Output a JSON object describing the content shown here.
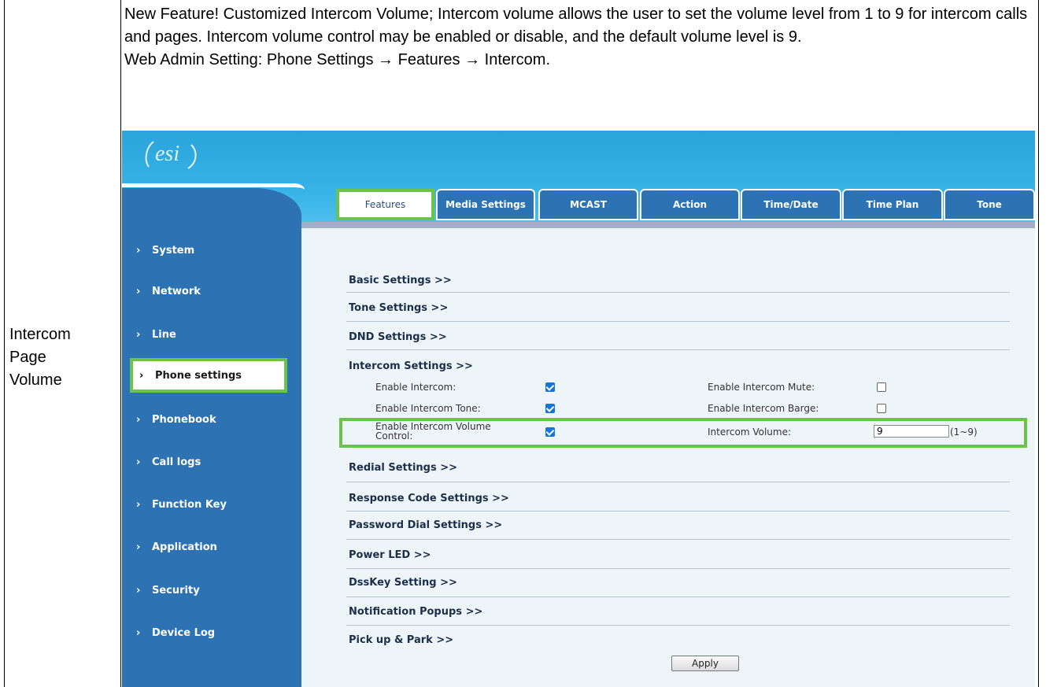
{
  "table": {
    "row_label_lines": [
      "Intercom",
      "Page",
      "Volume"
    ],
    "description": [
      "New Feature! Customized Intercom Volume; Intercom volume allows the user to set the volume level from 1 to 9 for intercom calls and pages. Intercom volume control may be enabled or disable, and the default volume level is 9.",
      "Web Admin Setting: Phone Settings → Features → Intercom."
    ]
  },
  "app": {
    "logo_text": "esi",
    "sidebar": [
      {
        "label": "System"
      },
      {
        "label": "Network"
      },
      {
        "label": "Line"
      },
      {
        "label": "Phone settings",
        "active": true
      },
      {
        "label": "Phonebook"
      },
      {
        "label": "Call logs"
      },
      {
        "label": "Function Key"
      },
      {
        "label": "Application"
      },
      {
        "label": "Security"
      },
      {
        "label": "Device Log"
      }
    ],
    "tabs": [
      {
        "label": "Features",
        "active": true
      },
      {
        "label": "Media Settings"
      },
      {
        "label": "MCAST"
      },
      {
        "label": "Action"
      },
      {
        "label": "Time/Date"
      },
      {
        "label": "Time Plan"
      },
      {
        "label": "Tone"
      }
    ],
    "sections": [
      "Basic Settings >>",
      "Tone Settings >>",
      "DND Settings >>",
      "Intercom Settings >>",
      "Redial Settings >>",
      "Response Code Settings >>",
      "Password Dial Settings >>",
      "Power LED >>",
      "DssKey Setting >>",
      "Notification Popups >>",
      "Pick up & Park >>"
    ],
    "intercom": {
      "enable_intercom": {
        "label": "Enable Intercom:",
        "checked": true
      },
      "enable_intercom_tone": {
        "label": "Enable Intercom Tone:",
        "checked": true
      },
      "enable_volume_control": {
        "label_line1": "Enable Intercom Volume",
        "label_line2": "Control:",
        "checked": true
      },
      "enable_intercom_mute": {
        "label": "Enable Intercom Mute:",
        "checked": false
      },
      "enable_intercom_barge": {
        "label": "Enable Intercom Barge:",
        "checked": false
      },
      "intercom_volume": {
        "label": "Intercom Volume:",
        "value": "9",
        "range": "(1~9)"
      }
    },
    "apply_label": "Apply",
    "colors": {
      "sidebar": "#2d73b3",
      "highlight": "#6cc24a",
      "header": "#37b3e6"
    }
  }
}
